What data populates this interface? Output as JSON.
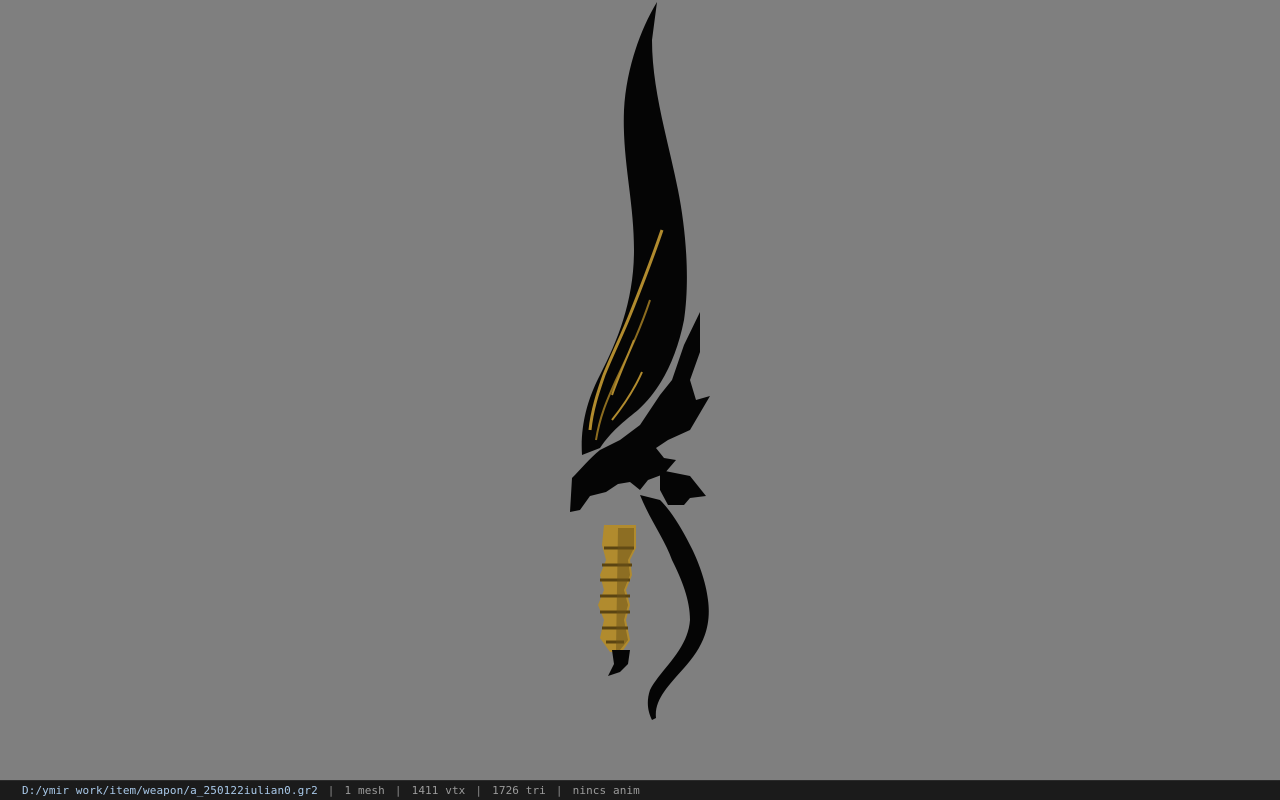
{
  "viewer": {
    "background_color": "#7f7f7f",
    "model": {
      "icon": "sword-model",
      "colors": {
        "blade": "#050505",
        "gold": "#b18b2e",
        "gold_dark": "#6a5218"
      }
    }
  },
  "statusbar": {
    "file_path": "D:/ymir work/item/weapon/a_250122iulian0.gr2",
    "separator": "|",
    "mesh_count": "1 mesh",
    "vertex_count": "1411 vtx",
    "triangle_count": "1726 tri",
    "anim": "nincs anim"
  }
}
